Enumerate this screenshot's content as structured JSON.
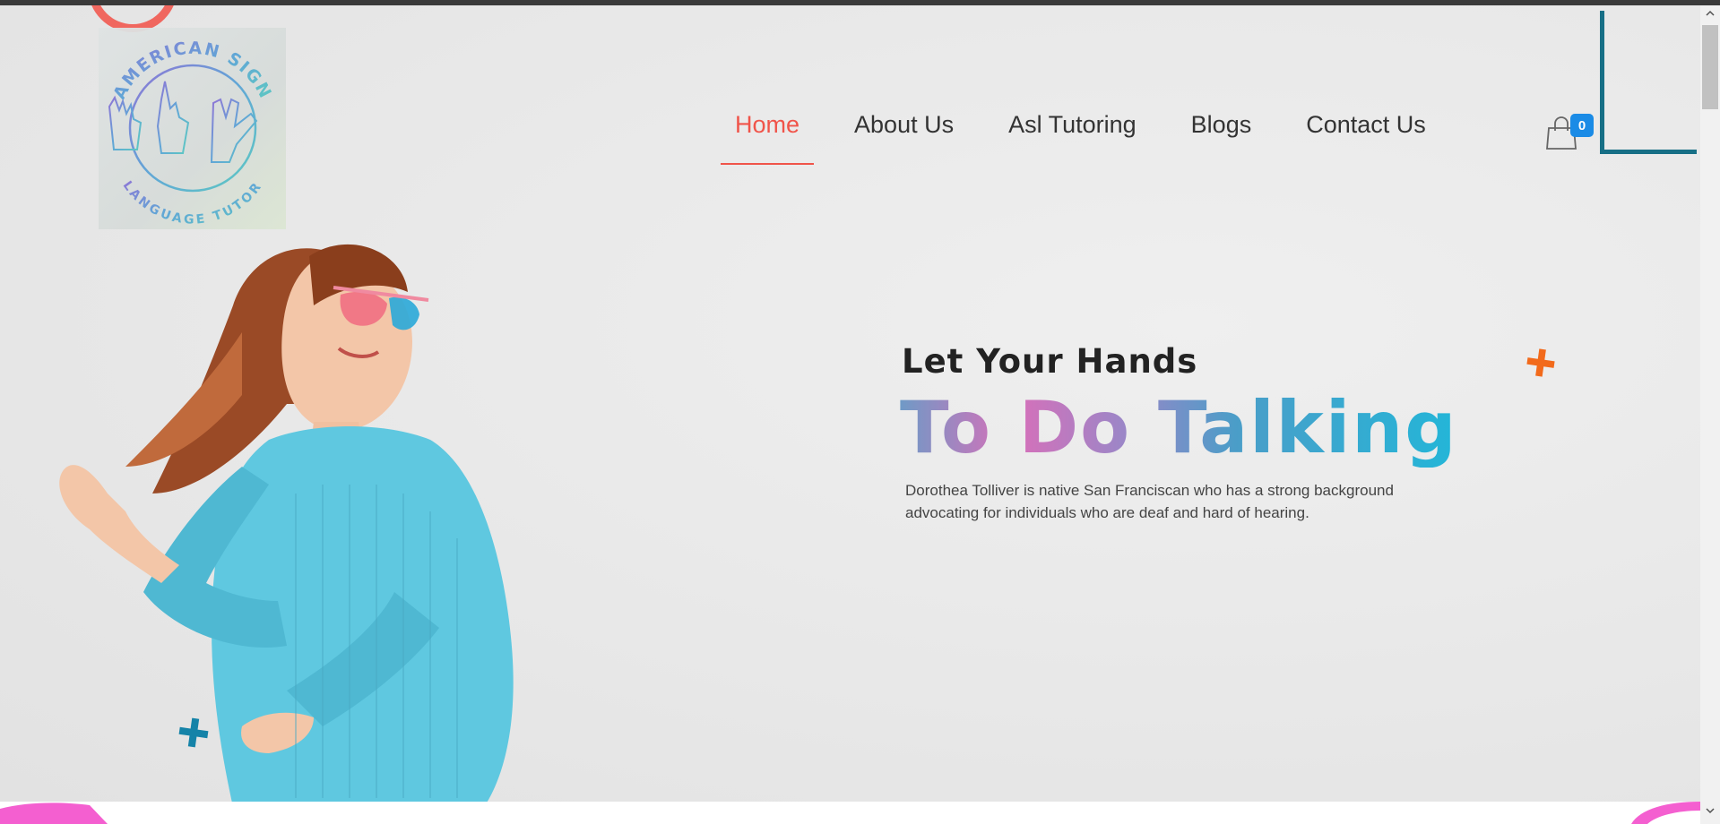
{
  "brand": {
    "logo_text_top": "AMERICAN SIGN",
    "logo_text_bottom": "LANGUAGE TUTOR"
  },
  "nav": {
    "items": [
      {
        "label": "Home",
        "active": true
      },
      {
        "label": "About Us",
        "active": false
      },
      {
        "label": "Asl Tutoring",
        "active": false
      },
      {
        "label": "Blogs",
        "active": false
      },
      {
        "label": "Contact Us",
        "active": false
      }
    ],
    "cart_icon": "shopping-bag-icon",
    "cart_count": "0"
  },
  "hero": {
    "subtitle": "Let Your Hands",
    "title": "To Do Talking",
    "description": "Dorothea Tolliver is native San Franciscan who has a strong background advocating for individuals who are deaf and hard of hearing."
  },
  "colors": {
    "accent_active": "#f0544a",
    "badge": "#1a8be6",
    "teal": "#176f86",
    "orange_plus": "#f26a1b",
    "blue_plus": "#1583a8",
    "sweater": "#5fc8e0"
  }
}
